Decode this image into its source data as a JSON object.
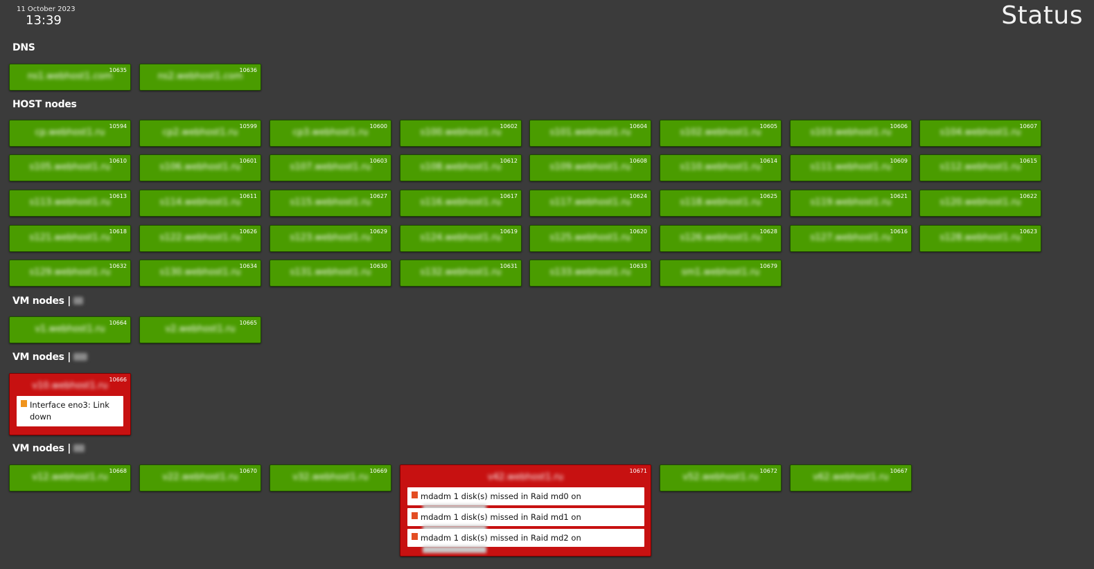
{
  "header": {
    "date": "11 October 2023",
    "time": "13:39",
    "title": "Status"
  },
  "sections": [
    {
      "title": "DNS",
      "suffix": ""
    },
    {
      "title": "HOST nodes",
      "suffix": ""
    },
    {
      "title": "VM nodes |",
      "suffix": ""
    },
    {
      "title": "VM nodes |",
      "suffix": ""
    },
    {
      "title": "VM nodes |",
      "suffix": ""
    }
  ],
  "dns": [
    {
      "id": "10635",
      "name": "ns1.webhost1.com"
    },
    {
      "id": "10636",
      "name": "ns2.webhost1.com"
    }
  ],
  "host_nodes": [
    {
      "id": "10594",
      "name": "cp.webhost1.ru"
    },
    {
      "id": "10599",
      "name": "cp2.webhost1.ru"
    },
    {
      "id": "10600",
      "name": "cp3.webhost1.ru"
    },
    {
      "id": "10602",
      "name": "s100.webhost1.ru"
    },
    {
      "id": "10604",
      "name": "s101.webhost1.ru"
    },
    {
      "id": "10605",
      "name": "s102.webhost1.ru"
    },
    {
      "id": "10606",
      "name": "s103.webhost1.ru"
    },
    {
      "id": "10607",
      "name": "s104.webhost1.ru"
    },
    {
      "id": "10610",
      "name": "s105.webhost1.ru"
    },
    {
      "id": "10601",
      "name": "s106.webhost1.ru"
    },
    {
      "id": "10603",
      "name": "s107.webhost1.ru"
    },
    {
      "id": "10612",
      "name": "s108.webhost1.ru"
    },
    {
      "id": "10608",
      "name": "s109.webhost1.ru"
    },
    {
      "id": "10614",
      "name": "s110.webhost1.ru"
    },
    {
      "id": "10609",
      "name": "s111.webhost1.ru"
    },
    {
      "id": "10615",
      "name": "s112.webhost1.ru"
    },
    {
      "id": "10613",
      "name": "s113.webhost1.ru"
    },
    {
      "id": "10611",
      "name": "s114.webhost1.ru"
    },
    {
      "id": "10627",
      "name": "s115.webhost1.ru"
    },
    {
      "id": "10617",
      "name": "s116.webhost1.ru"
    },
    {
      "id": "10624",
      "name": "s117.webhost1.ru"
    },
    {
      "id": "10625",
      "name": "s118.webhost1.ru"
    },
    {
      "id": "10621",
      "name": "s119.webhost1.ru"
    },
    {
      "id": "10622",
      "name": "s120.webhost1.ru"
    },
    {
      "id": "10618",
      "name": "s121.webhost1.ru"
    },
    {
      "id": "10626",
      "name": "s122.webhost1.ru"
    },
    {
      "id": "10629",
      "name": "s123.webhost1.ru"
    },
    {
      "id": "10619",
      "name": "s124.webhost1.ru"
    },
    {
      "id": "10620",
      "name": "s125.webhost1.ru"
    },
    {
      "id": "10628",
      "name": "s126.webhost1.ru"
    },
    {
      "id": "10616",
      "name": "s127.webhost1.ru"
    },
    {
      "id": "10623",
      "name": "s128.webhost1.ru"
    },
    {
      "id": "10632",
      "name": "s129.webhost1.ru"
    },
    {
      "id": "10634",
      "name": "s130.webhost1.ru"
    },
    {
      "id": "10630",
      "name": "s131.webhost1.ru"
    },
    {
      "id": "10631",
      "name": "s132.webhost1.ru"
    },
    {
      "id": "10633",
      "name": "s133.webhost1.ru"
    },
    {
      "id": "10679",
      "name": "sm1.webhost1.ru"
    }
  ],
  "vm_group1": [
    {
      "id": "10664",
      "name": "v1.webhost1.ru"
    },
    {
      "id": "10665",
      "name": "v2.webhost1.ru"
    }
  ],
  "vm_group2": [
    {
      "id": "10666",
      "name": "v10.webhost1.ru",
      "problems": [
        "Interface eno3: Link down"
      ]
    }
  ],
  "vm_group3": [
    {
      "id": "10668",
      "name": "v12.webhost1.ru"
    },
    {
      "id": "10670",
      "name": "v22.webhost1.ru"
    },
    {
      "id": "10669",
      "name": "v32.webhost1.ru"
    },
    {
      "id": "10671",
      "name": "v42.webhost1.ru",
      "problems": [
        "mdadm 1 disk(s) missed in Raid md0 on",
        "mdadm 1 disk(s) missed in Raid md1 on",
        "mdadm 1 disk(s) missed in Raid md2 on"
      ]
    },
    {
      "id": "10672",
      "name": "v52.webhost1.ru"
    },
    {
      "id": "10667",
      "name": "v62.webhost1.ru"
    }
  ],
  "colors": {
    "ok": "#4a9c00",
    "alert": "#c71111",
    "severity_average": "#f0941d",
    "severity_high": "#e34d23",
    "background": "#3b3b3b"
  }
}
